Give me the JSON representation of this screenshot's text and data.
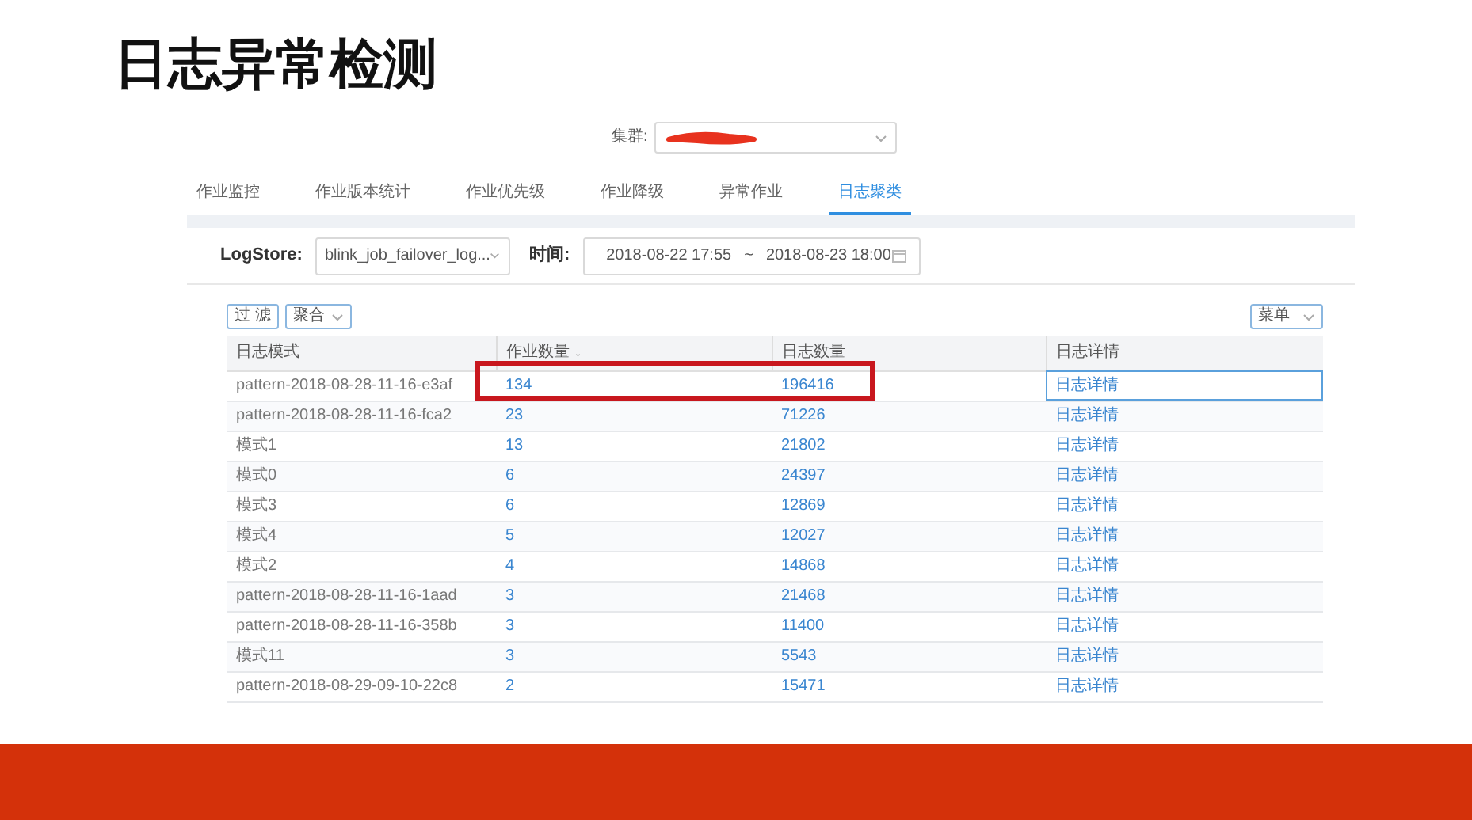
{
  "slide_title": "日志异常检测",
  "cluster": {
    "label": "集群:",
    "redacted": true
  },
  "tabs": [
    {
      "label": "作业监控",
      "selected": false
    },
    {
      "label": "作业版本统计",
      "selected": false
    },
    {
      "label": "作业优先级",
      "selected": false
    },
    {
      "label": "作业降级",
      "selected": false
    },
    {
      "label": "异常作业",
      "selected": false
    },
    {
      "label": "日志聚类",
      "selected": true
    }
  ],
  "filters": {
    "logstore_label": "LogStore:",
    "logstore_value": "blink_job_failover_log...",
    "time_label": "时间:",
    "start": "2018-08-22 17:55",
    "separator": "~",
    "end": "2018-08-23 18:00"
  },
  "toolbar": {
    "filter_button": "过 滤",
    "aggregate_button": "聚合",
    "menu_button": "菜单"
  },
  "table": {
    "columns": [
      {
        "label": "日志模式"
      },
      {
        "label": "作业数量",
        "sort_mark": "↓"
      },
      {
        "label": "日志数量"
      },
      {
        "label": "日志详情"
      }
    ],
    "rows": [
      {
        "cells": [
          "pattern-2018-08-28-11-16-e3af",
          "134",
          "196416",
          "日志详情"
        ],
        "highlighted": true,
        "focused": true
      },
      {
        "cells": [
          "pattern-2018-08-28-11-16-fca2",
          "23",
          "71226",
          "日志详情"
        ],
        "highlighted": false,
        "focused": false
      },
      {
        "cells": [
          "模式1",
          "13",
          "21802",
          "日志详情"
        ],
        "highlighted": false,
        "focused": false
      },
      {
        "cells": [
          "模式0",
          "6",
          "24397",
          "日志详情"
        ],
        "highlighted": false,
        "focused": false
      },
      {
        "cells": [
          "模式3",
          "6",
          "12869",
          "日志详情"
        ],
        "highlighted": false,
        "focused": false
      },
      {
        "cells": [
          "模式4",
          "5",
          "12027",
          "日志详情"
        ],
        "highlighted": false,
        "focused": false
      },
      {
        "cells": [
          "模式2",
          "4",
          "14868",
          "日志详情"
        ],
        "highlighted": false,
        "focused": false
      },
      {
        "cells": [
          "pattern-2018-08-28-11-16-1aad",
          "3",
          "21468",
          "日志详情"
        ],
        "highlighted": false,
        "focused": false
      },
      {
        "cells": [
          "pattern-2018-08-28-11-16-358b",
          "3",
          "11400",
          "日志详情"
        ],
        "highlighted": false,
        "focused": false
      },
      {
        "cells": [
          "模式11",
          "3",
          "5543",
          "日志详情"
        ],
        "highlighted": false,
        "focused": false
      },
      {
        "cells": [
          "pattern-2018-08-29-09-10-22c8",
          "2",
          "15471",
          "日志详情"
        ],
        "highlighted": false,
        "focused": false
      }
    ]
  }
}
